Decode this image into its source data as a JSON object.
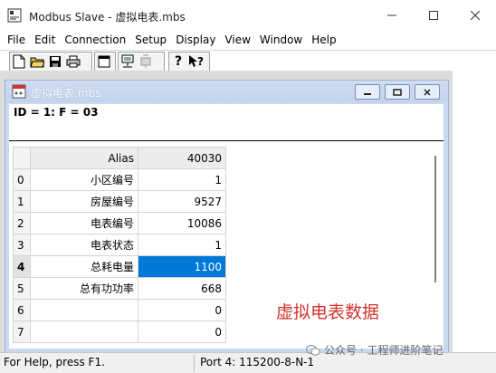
{
  "app": {
    "title": "Modbus Slave - 虚拟电表.mbs"
  },
  "menu": [
    "File",
    "Edit",
    "Connection",
    "Setup",
    "Display",
    "View",
    "Window",
    "Help"
  ],
  "toolbar": {
    "icons": [
      "new-file-icon",
      "open-folder-icon",
      "save-icon",
      "print-icon",
      "window-icon",
      "connect-icon",
      "disconnect-icon",
      "help-icon",
      "context-help-icon"
    ]
  },
  "child": {
    "title": "虚拟电表.mbs",
    "id_line": "ID = 1: F = 03",
    "grid": {
      "header": {
        "alias": "Alias",
        "address": "40030"
      },
      "rows": [
        {
          "num": "0",
          "alias": "小区编号",
          "value": "1"
        },
        {
          "num": "1",
          "alias": "房屋编号",
          "value": "9527"
        },
        {
          "num": "2",
          "alias": "电表编号",
          "value": "10086"
        },
        {
          "num": "3",
          "alias": "电表状态",
          "value": "1"
        },
        {
          "num": "4",
          "alias": "总耗电量",
          "value": "1100"
        },
        {
          "num": "5",
          "alias": "总有功功率",
          "value": "668"
        },
        {
          "num": "6",
          "alias": "",
          "value": "0"
        },
        {
          "num": "7",
          "alias": "",
          "value": "0"
        }
      ]
    },
    "overlay_label": "虚拟电表数据"
  },
  "status": {
    "left": "For Help, press F1.",
    "right": "Port 4: 115200-8-N-1"
  },
  "watermark": "公众号 · 工程师进阶笔记",
  "colors": {
    "selection": "#0078d7",
    "overlay_text": "#d4322a"
  }
}
